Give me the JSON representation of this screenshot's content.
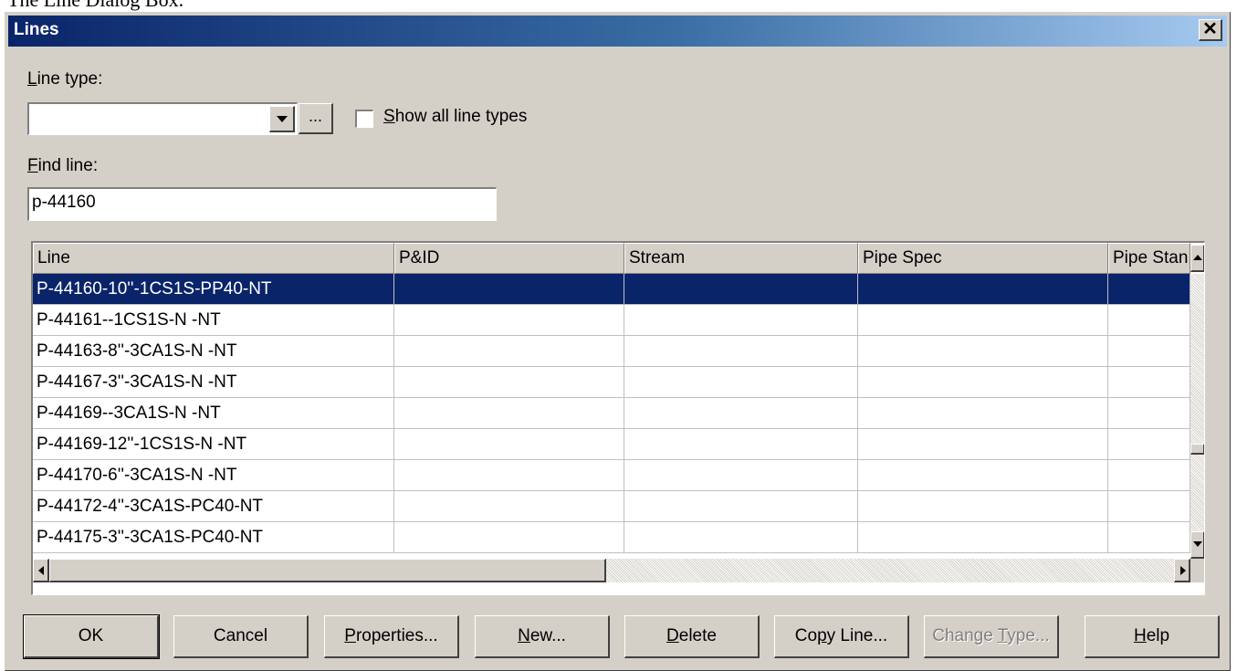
{
  "caption": "The Line Dialog Box.",
  "window": {
    "title": "Lines",
    "close_glyph": "✕"
  },
  "line_type": {
    "label_key": "L",
    "label_rest": "ine type:",
    "value": "",
    "browse_label": "...",
    "show_all_key": "S",
    "show_all_rest": "how all line types",
    "show_all_checked": false
  },
  "find_line": {
    "label_key": "F",
    "label_rest": "ind line:",
    "value": "p-44160"
  },
  "table": {
    "columns": [
      "Line",
      "P&ID",
      "Stream",
      "Pipe Spec",
      "Pipe Stan"
    ],
    "rows": [
      "P-44160-10''-1CS1S-PP40-NT",
      "P-44161--1CS1S-N -NT",
      "P-44163-8''-3CA1S-N -NT",
      "P-44167-3''-3CA1S-N -NT",
      "P-44169--3CA1S-N -NT",
      "P-44169-12''-1CS1S-N -NT",
      "P-44170-6''-3CA1S-N -NT",
      "P-44172-4''-3CA1S-PC40-NT",
      "P-44175-3''-3CA1S-PC40-NT"
    ],
    "selected_index": 0
  },
  "buttons": {
    "ok": "OK",
    "cancel": "Cancel",
    "properties_key": "P",
    "properties_rest": "roperties...",
    "new_key": "N",
    "new_rest": "ew...",
    "delete_key": "D",
    "delete_rest": "elete",
    "copy_pre": "Co",
    "copy_key": "p",
    "copy_rest": "y Line...",
    "change_pre": "Change ",
    "change_key": "T",
    "change_rest": "ype...",
    "help_key": "H",
    "help_rest": "elp"
  },
  "colors": {
    "dialog_face": "#d4d0c8",
    "title_start": "#0a246a",
    "title_end": "#a6caf0",
    "selection": "#0a246a"
  }
}
